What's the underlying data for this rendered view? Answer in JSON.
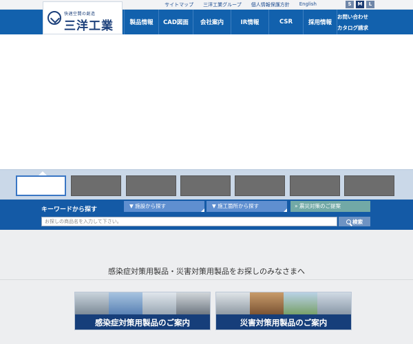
{
  "utility": {
    "links": [
      "サイトマップ",
      "三洋工業グループ",
      "個人情報保護方針",
      "English"
    ],
    "font_sizes": [
      "S",
      "M",
      "L"
    ],
    "font_size_selected": "M"
  },
  "logo": {
    "tagline": "快適空間の創造",
    "name": "三洋工業"
  },
  "nav": {
    "items": [
      "製品情報",
      "CAD図面",
      "会社案内",
      "IR情報",
      "CSR",
      "採用情報"
    ],
    "side": [
      "お問い合わせ",
      "カタログ請求"
    ]
  },
  "search": {
    "label": "キーワードから探す",
    "pills": [
      "▼ 施設から探す",
      "▼ 施工箇所から探す",
      "» 震災対策のご提案"
    ],
    "placeholder": "お探しの商品名を入力して下さい。",
    "button_label": "検索"
  },
  "lower": {
    "title": "感染症対策用製品・災害対策用製品をお探しのみなさまへ",
    "banners": [
      "感染症対策用製品のご案内",
      "災害対策用製品のご案内"
    ]
  },
  "colors": {
    "nav_blue": "#1261ad",
    "banner_navy": "#163e7a",
    "search_band": "#145aa6"
  }
}
